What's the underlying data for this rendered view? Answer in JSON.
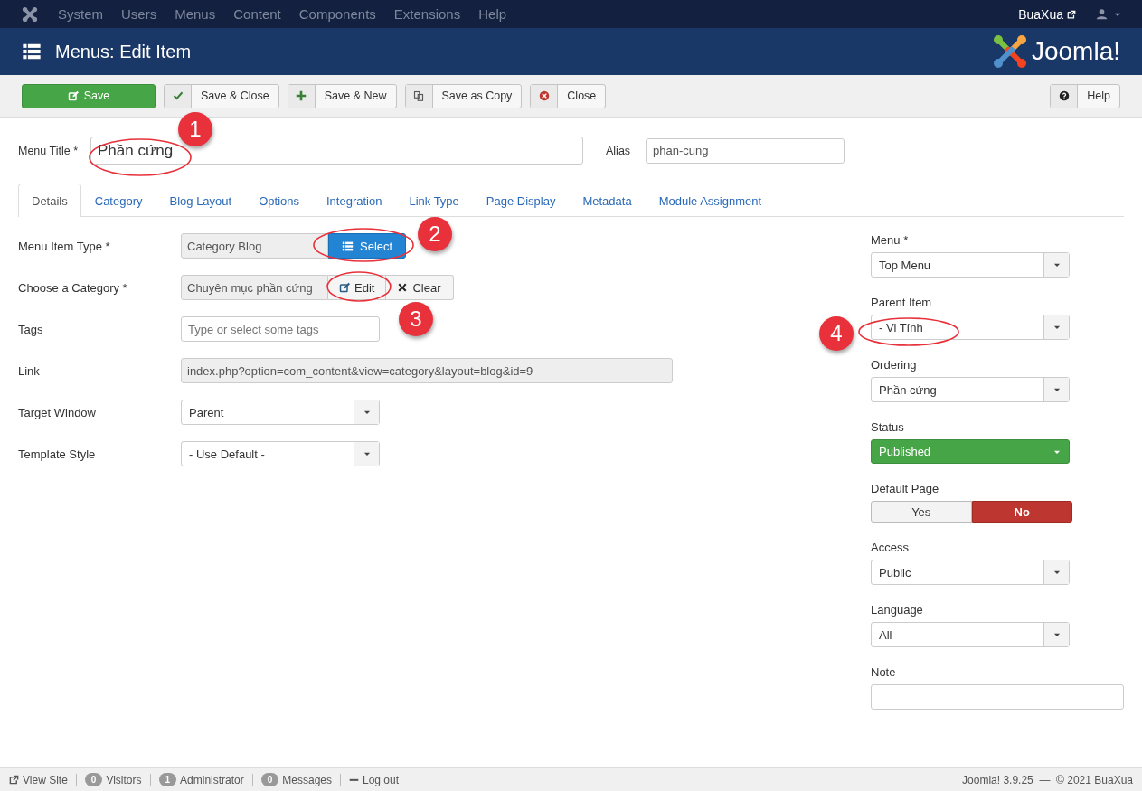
{
  "top_nav": {
    "menus": [
      "System",
      "Users",
      "Menus",
      "Content",
      "Components",
      "Extensions",
      "Help"
    ],
    "site_link": "BuaXua"
  },
  "header": {
    "title": "Menus: Edit Item",
    "logo_text": "Joomla!"
  },
  "toolbar": {
    "buttons": [
      {
        "label": "Save",
        "kind": "primary"
      },
      {
        "label": "Save & Close",
        "kind": "default"
      },
      {
        "label": "Save & New",
        "kind": "default"
      },
      {
        "label": "Save as Copy",
        "kind": "default"
      },
      {
        "label": "Close",
        "kind": "default"
      }
    ],
    "help": {
      "label": "Help"
    }
  },
  "title_row": {
    "menu_title": {
      "label": "Menu Title *",
      "value": "Phần cứng"
    },
    "alias": {
      "label": "Alias",
      "value": "phan-cung"
    }
  },
  "tabs": [
    {
      "label": "Details",
      "selected": true
    },
    {
      "label": "Category",
      "selected": false
    },
    {
      "label": "Blog Layout",
      "selected": false
    },
    {
      "label": "Options",
      "selected": false
    },
    {
      "label": "Integration",
      "selected": false
    },
    {
      "label": "Link Type",
      "selected": false
    },
    {
      "label": "Page Display",
      "selected": false
    },
    {
      "label": "Metadata",
      "selected": false
    },
    {
      "label": "Module Assignment",
      "selected": false
    }
  ],
  "fields": [
    {
      "label": "Menu Item Type *",
      "kind": "type",
      "value": "Category Blog",
      "button": "Select"
    },
    {
      "label": "Choose a Category *",
      "kind": "category",
      "value": "Chuyên mục phần cứng",
      "edit": "Edit",
      "clear": "Clear"
    },
    {
      "label": "Tags",
      "kind": "tags",
      "placeholder": "Type or select some tags"
    },
    {
      "label": "Link",
      "kind": "link",
      "value": "index.php?option=com_content&view=category&layout=blog&id=9"
    },
    {
      "label": "Target Window",
      "kind": "dropdown",
      "value": "Parent"
    },
    {
      "label": "Template Style",
      "kind": "dropdown",
      "value": "- Use Default -"
    }
  ],
  "side_fields": [
    {
      "label": "Menu *",
      "kind": "dropdown",
      "value": "Top Menu"
    },
    {
      "label": "Parent Item",
      "kind": "dropdown",
      "value": "- Vi Tính"
    },
    {
      "label": "Ordering",
      "kind": "dropdown",
      "value": "Phần cứng"
    },
    {
      "label": "Status",
      "kind": "status",
      "value": "Published"
    },
    {
      "label": "Default Page",
      "kind": "toggle",
      "options": [
        {
          "label": "Yes",
          "selected": false
        },
        {
          "label": "No",
          "selected": true
        }
      ]
    },
    {
      "label": "Access",
      "kind": "dropdown",
      "value": "Public"
    },
    {
      "label": "Language",
      "kind": "dropdown",
      "value": "All"
    },
    {
      "label": "Note",
      "kind": "text"
    }
  ],
  "annotations": [
    "1",
    "2",
    "3",
    "4"
  ],
  "status_bar": {
    "items": [
      {
        "kind": "link",
        "label": "View Site"
      },
      {
        "kind": "count",
        "count": "0",
        "label": "Visitors"
      },
      {
        "kind": "count",
        "count": "1",
        "label": "Administrator"
      },
      {
        "kind": "count",
        "count": "0",
        "label": "Messages"
      },
      {
        "kind": "logout",
        "label": "Log out"
      }
    ],
    "footer_text": "Joomla! 3.9.25  —  © 2021 BuaXua"
  }
}
